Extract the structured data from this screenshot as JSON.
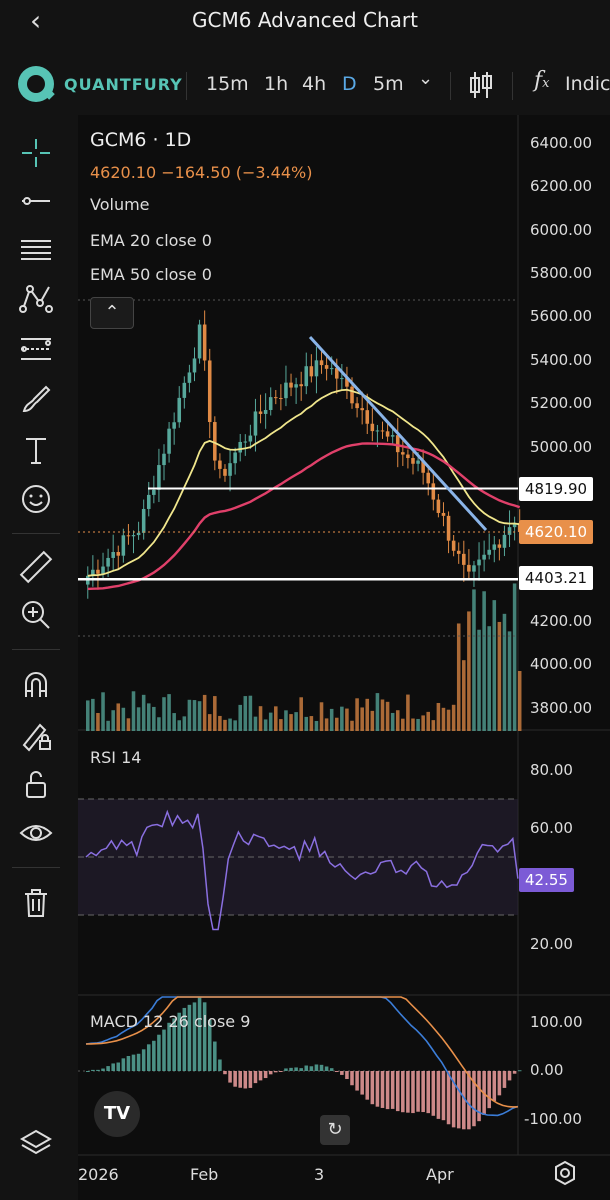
{
  "header": {
    "title": "GCM6 Advanced Chart",
    "back_icon": "chevron-left-icon"
  },
  "toolbar": {
    "brand": "QUANTFURY",
    "timeframes": [
      {
        "label": "15m",
        "active": false
      },
      {
        "label": "1h",
        "active": false
      },
      {
        "label": "4h",
        "active": false
      },
      {
        "label": "D",
        "active": true
      },
      {
        "label": "5m",
        "active": false
      }
    ],
    "indicators_label": "Indic"
  },
  "legend": {
    "symbol": "GCM6 · 1D",
    "price_change": "4620.10  −164.50 (−3.44%)",
    "volume": "Volume",
    "ema20": "EMA 20 close 0",
    "ema50": "EMA 50 close 0"
  },
  "price_axis": [
    "6400.00",
    "6200.00",
    "6000.00",
    "5800.00",
    "5600.00",
    "5400.00",
    "5200.00",
    "5000.00",
    "4200.00",
    "4000.00",
    "3800.00"
  ],
  "price_tags": {
    "resistance": "4819.90",
    "last": "4620.10",
    "support": "4403.21"
  },
  "rsi": {
    "label": "RSI 14",
    "axis": [
      "80.00",
      "60.00",
      "20.00"
    ],
    "value": "42.55"
  },
  "macd": {
    "label": "MACD 12 26 close 9",
    "axis": [
      "100.00",
      "0.00",
      "-100.00"
    ]
  },
  "time_axis": [
    "2026",
    "Feb",
    "3",
    "Apr"
  ],
  "colors": {
    "bull": "#57a89b",
    "bear": "#e08a45",
    "ema20": "#f0e68c",
    "ema50": "#e0406a",
    "trend": "#8ab4e8",
    "rsi": "#8a6fe0"
  },
  "chart_data": {
    "type": "candlestick",
    "symbol": "GCM6",
    "interval": "1D",
    "last": 4620.1,
    "change": -164.5,
    "change_pct": -3.44,
    "horizontal_levels": [
      4819.9,
      4403.21
    ],
    "ylim": [
      3700,
      6450
    ],
    "rsi_last": 42.55
  }
}
